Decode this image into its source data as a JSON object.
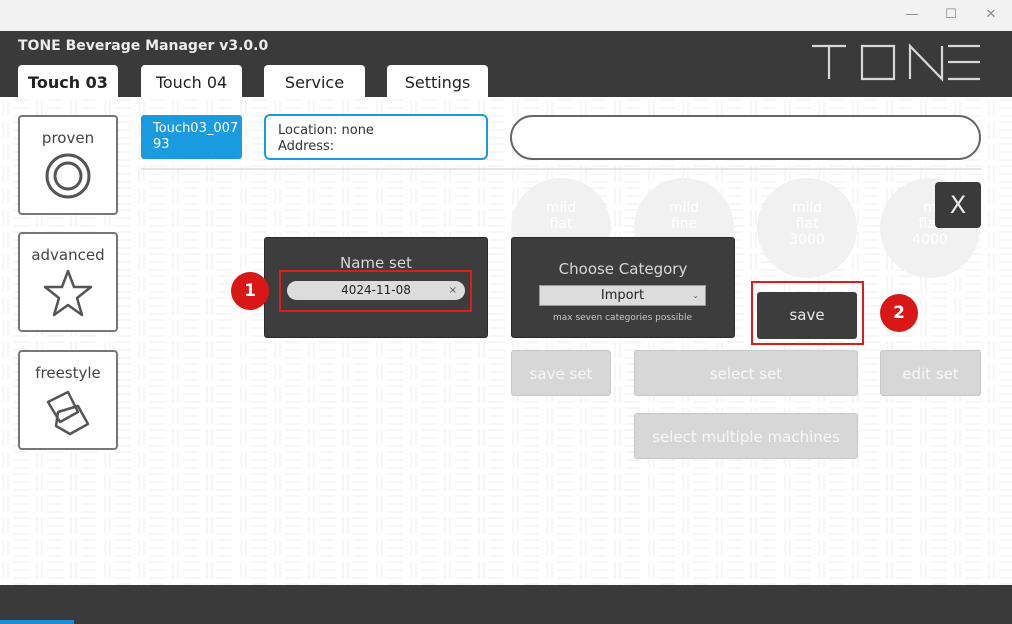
{
  "window": {
    "app_title": "TONE Beverage Manager v3.0.0",
    "logo_text": "TONE",
    "controls": {
      "minimize": "—",
      "maximize": "☐",
      "close": "✕"
    }
  },
  "tabs": [
    {
      "label": "Touch 03",
      "active": true
    },
    {
      "label": "Touch 04",
      "active": false
    },
    {
      "label": "Service",
      "active": false
    },
    {
      "label": "Settings",
      "active": false
    }
  ],
  "modes": [
    {
      "label": "proven",
      "icon": "target-icon"
    },
    {
      "label": "advanced",
      "icon": "star-icon"
    },
    {
      "label": "freestyle",
      "icon": "cubes-icon"
    }
  ],
  "machine": {
    "id_label": "Touch03_00793",
    "location": "Location: none",
    "address": "Address:"
  },
  "search": {
    "value": ""
  },
  "ghost_circles": [
    {
      "line1": "mild",
      "line2": "flat"
    },
    {
      "line1": "mild",
      "line2": "fine"
    },
    {
      "line1": "mild",
      "line2": "flat",
      "line3": "3000"
    },
    {
      "line1": "m",
      "line2": "flat",
      "line3": "4000"
    }
  ],
  "close_button": "X",
  "name_set": {
    "title": "Name set",
    "value": "4024-11-08",
    "clear": "×"
  },
  "category": {
    "title": "Choose Category",
    "selected": "Import",
    "hint": "max seven categories possible"
  },
  "buttons": {
    "save": "save",
    "save_set": "save set",
    "select_set": "select set",
    "edit_set": "edit set",
    "select_multiple": "select multiple machines"
  },
  "callouts": [
    "1",
    "2"
  ],
  "colors": {
    "accent": "#1a9be0",
    "dark": "#3a3a3a",
    "highlight": "#e01b1b"
  }
}
